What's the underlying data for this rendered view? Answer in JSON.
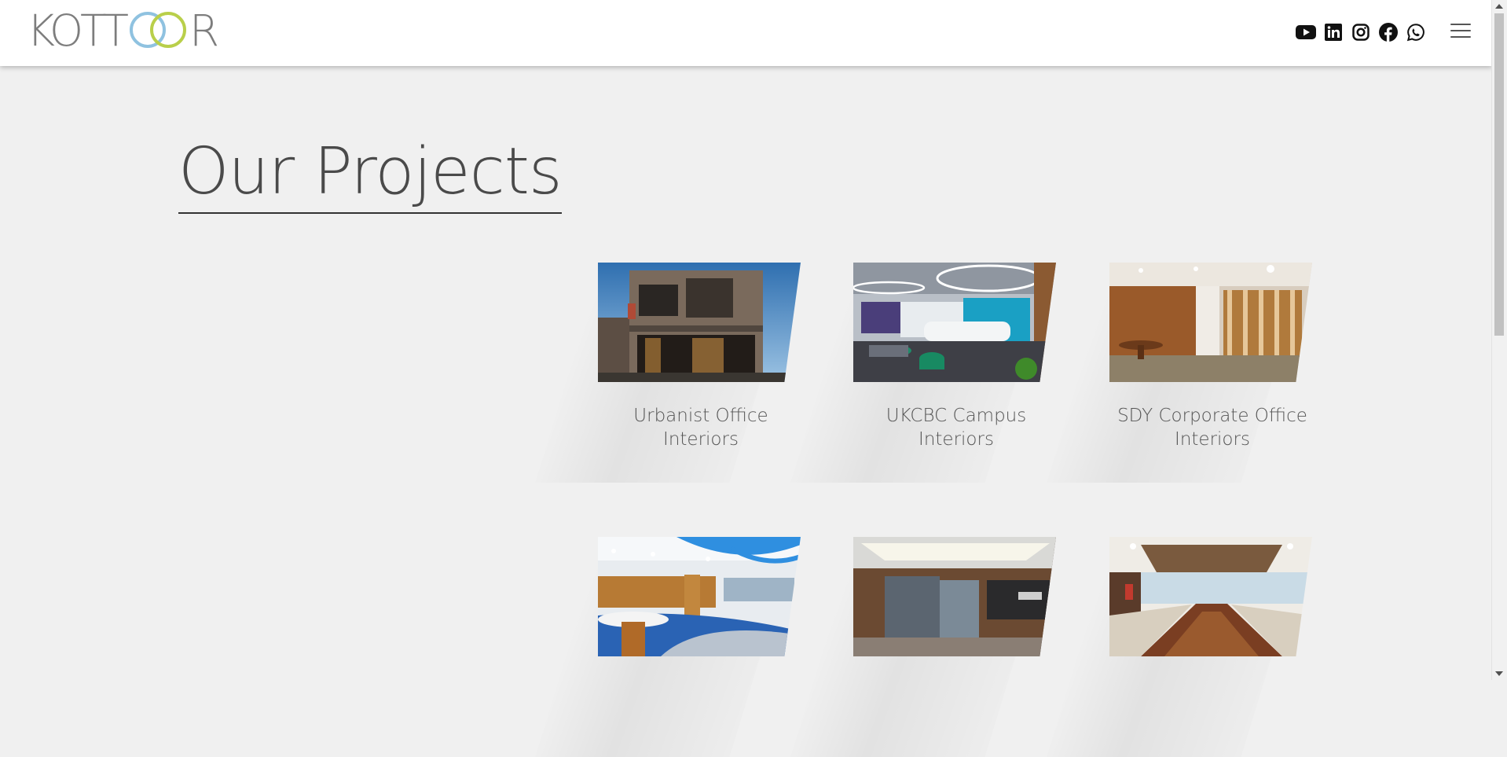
{
  "header": {
    "logo_text": "KOTTOOR",
    "social": [
      {
        "icon": "youtube-icon"
      },
      {
        "icon": "linkedin-icon"
      },
      {
        "icon": "instagram-icon"
      },
      {
        "icon": "facebook-icon"
      },
      {
        "icon": "whatsapp-icon"
      }
    ],
    "menu_icon": "hamburger-menu-icon"
  },
  "main": {
    "title": "Our Projects",
    "projects": [
      {
        "caption": "Urbanist Office Interiors"
      },
      {
        "caption": "UKCBC Campus Interiors"
      },
      {
        "caption": "SDY Corporate Office Interiors"
      },
      {
        "caption": ""
      },
      {
        "caption": ""
      },
      {
        "caption": ""
      }
    ]
  },
  "colors": {
    "background": "#f0f0f0",
    "header": "#ffffff",
    "logo_gray": "#7d7d7d",
    "logo_blue": "#8fc2e0",
    "logo_green": "#b9cf4a",
    "text": "#4a4a4a"
  }
}
